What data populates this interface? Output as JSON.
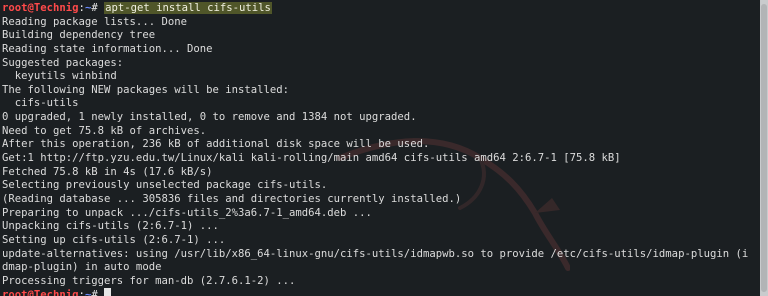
{
  "prompt": {
    "user": "root@Technig",
    "sep": ":",
    "path": "~",
    "symbol": "#"
  },
  "command": "apt-get install cifs-utils",
  "output": [
    "Reading package lists... Done",
    "Building dependency tree",
    "Reading state information... Done",
    "Suggested packages:",
    "  keyutils winbind",
    "The following NEW packages will be installed:",
    "  cifs-utils",
    "0 upgraded, 1 newly installed, 0 to remove and 1384 not upgraded.",
    "Need to get 75.8 kB of archives.",
    "After this operation, 236 kB of additional disk space will be used.",
    "Get:1 http://ftp.yzu.edu.tw/Linux/kali kali-rolling/main amd64 cifs-utils amd64 2:6.7-1 [75.8 kB]",
    "Fetched 75.8 kB in 4s (17.6 kB/s)",
    "Selecting previously unselected package cifs-utils.",
    "(Reading database ... 305836 files and directories currently installed.)",
    "Preparing to unpack .../cifs-utils_2%3a6.7-1_amd64.deb ...",
    "Unpacking cifs-utils (2:6.7-1) ...",
    "Setting up cifs-utils (2:6.7-1) ...",
    "update-alternatives: using /usr/lib/x86_64-linux-gnu/cifs-utils/idmapwb.so to provide /etc/cifs-utils/idmap-plugin (i",
    "dmap-plugin) in auto mode",
    "Processing triggers for man-db (2.7.6.1-2) ..."
  ],
  "colors": {
    "background": "#1b1f22",
    "text": "#dcdcdc",
    "prompt_user": "#ff4a4a",
    "prompt_path": "#6c8cff",
    "highlight": "#dce63c"
  }
}
